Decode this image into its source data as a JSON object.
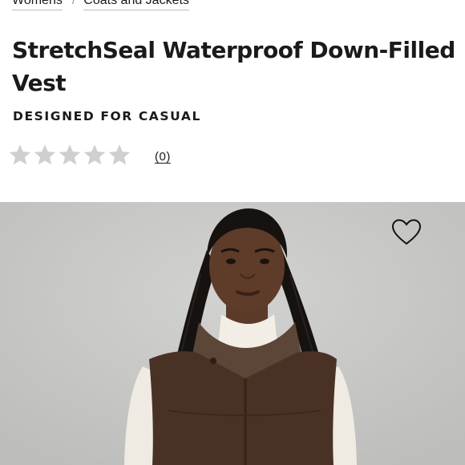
{
  "breadcrumb": {
    "items": [
      "Womens",
      "Coats and Jackets"
    ],
    "separator": "/"
  },
  "product": {
    "title": "StretchSeal Waterproof Down-Filled Vest",
    "subtitle": "DESIGNED FOR CASUAL",
    "rating": {
      "stars": 0,
      "max_stars": 5,
      "review_count_label": "(0)"
    }
  },
  "icons": {
    "star": "star-icon",
    "wishlist": "heart-icon"
  },
  "colors": {
    "star_empty": "#cfcfcf",
    "hero_background": "#c8c8c6",
    "vest": "#4a3126",
    "collar_fleece": "#5c4637",
    "turtleneck": "#f1ede4"
  }
}
